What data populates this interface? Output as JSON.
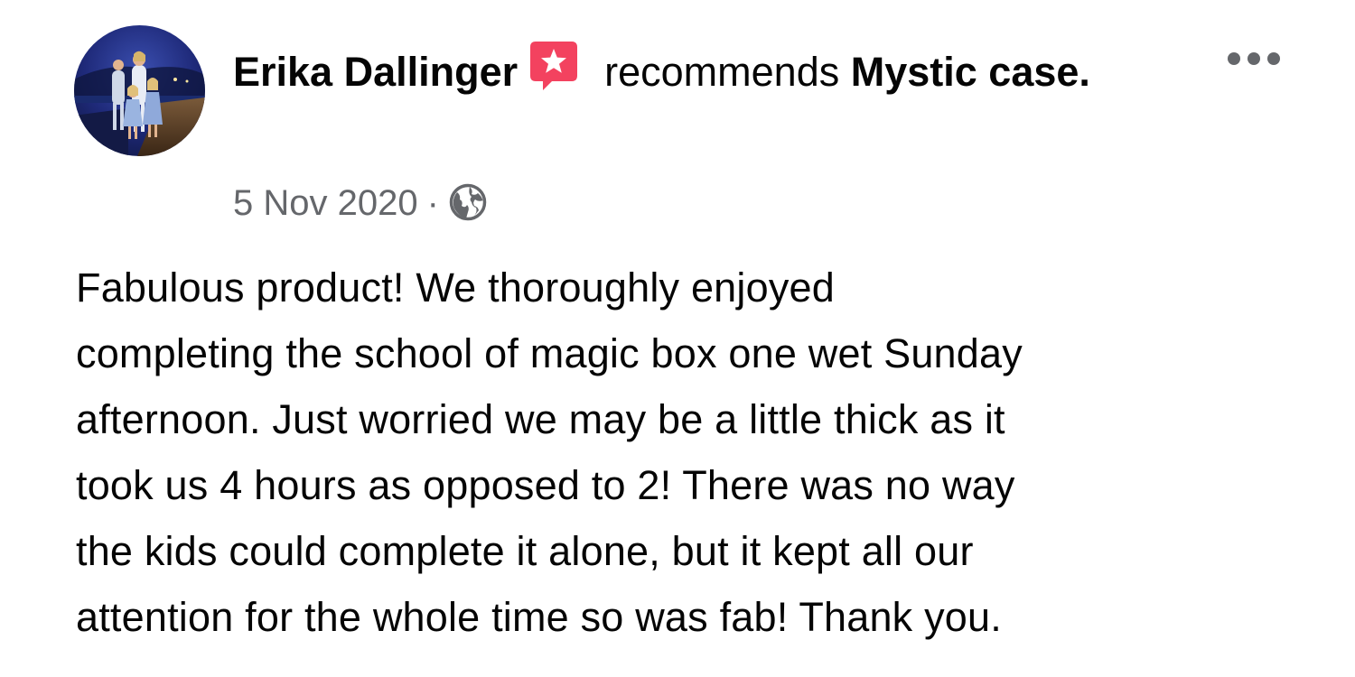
{
  "post": {
    "author": "Erika Dallinger",
    "action": "recommends",
    "page_name": "Mystic case.",
    "date": "5 Nov 2020",
    "separator": "·",
    "privacy_icon": "globe-icon",
    "recommend_badge_icon": "star-speech-bubble-icon",
    "more_icon": "more-options-icon",
    "text": "Fabulous product!  We thoroughly enjoyed\ncompleting the school of magic box one wet Sunday\nafternoon.  Just worried we may be a little thick as it\ntook us 4 hours as opposed to 2!  There was no way\nthe kids could complete it alone, but it kept all our\nattention for the whole time so was fab!  Thank you."
  },
  "colors": {
    "badge": "#f3425f",
    "secondary_text": "#65676b",
    "primary_text": "#050505"
  }
}
